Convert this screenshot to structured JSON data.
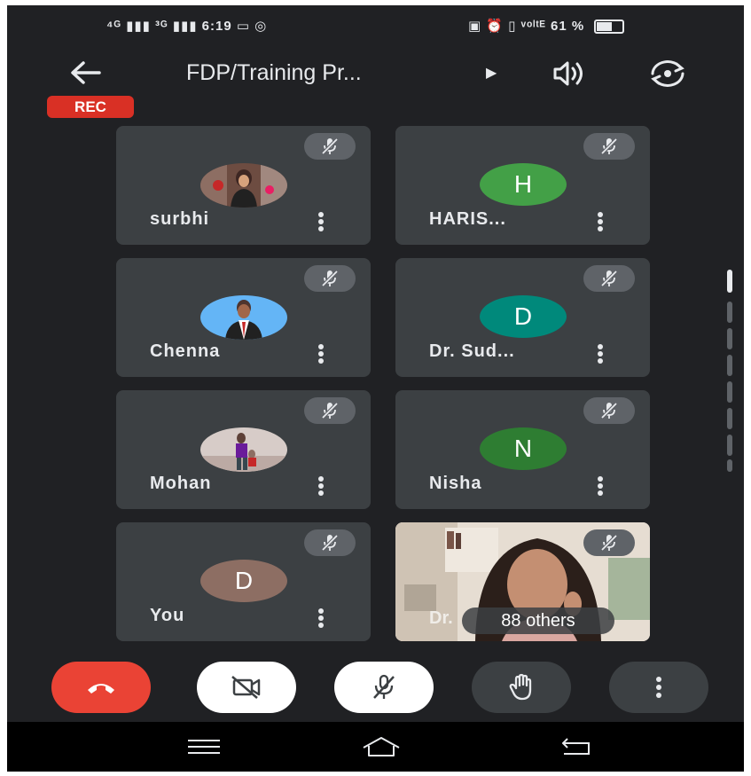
{
  "status_bar": {
    "left": "⁴ᴳ ▮▮▮ ³ᴳ ▮▮▮ 6:19 ▭ ◎",
    "right": "▣ ⏰ ▯ ᵛᵒˡᵗᴱ 61 %"
  },
  "header": {
    "title": "FDP/Training Pr...",
    "rec_label": "REC"
  },
  "participants": [
    {
      "name": "surbhi",
      "avatar": "photo",
      "muted": true
    },
    {
      "name": "HARIS...",
      "avatar": "letter",
      "initial": "H",
      "color": "#43a047",
      "muted": true
    },
    {
      "name": "Chenna",
      "avatar": "photo",
      "muted": true
    },
    {
      "name": "Dr. Sud...",
      "avatar": "letter",
      "initial": "D",
      "color": "#00897b",
      "muted": true
    },
    {
      "name": "Mohan",
      "avatar": "photo",
      "muted": true
    },
    {
      "name": "Nisha",
      "avatar": "letter",
      "initial": "N",
      "color": "#2e7d32",
      "muted": true
    },
    {
      "name": "You",
      "avatar": "letter",
      "initial": "D",
      "color": "#8d6e63",
      "muted": true
    }
  ],
  "others_tile": {
    "name_fragment": "Dr.",
    "label": "88 others"
  },
  "controls": [
    "end-call",
    "camera-off",
    "mic-off",
    "raise-hand",
    "more-options"
  ],
  "colors": {
    "background": "#202124",
    "tile": "#3c4043",
    "end_call": "#ea4335",
    "rec": "#d93025"
  }
}
